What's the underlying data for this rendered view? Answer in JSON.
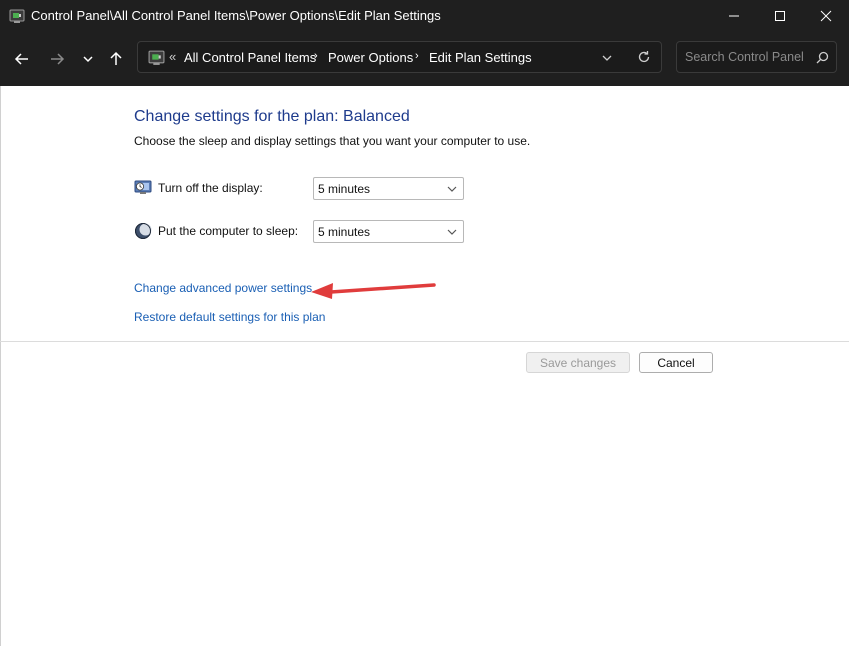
{
  "window": {
    "title": "Control Panel\\All Control Panel Items\\Power Options\\Edit Plan Settings",
    "controls": {
      "minimize": "minimize-icon",
      "maximize": "maximize-icon",
      "close": "close-icon"
    }
  },
  "navigation": {
    "back": "arrow-left-icon",
    "forward": "arrow-right-icon",
    "recent": "chevron-down-icon",
    "up": "arrow-up-icon"
  },
  "address": {
    "overflow": "«",
    "crumbs": [
      "All Control Panel Items",
      "Power Options",
      "Edit Plan Settings"
    ],
    "separator": "›"
  },
  "search": {
    "placeholder": "Search Control Panel"
  },
  "main": {
    "heading": "Change settings for the plan: Balanced",
    "description": "Choose the sleep and display settings that you want your computer to use.",
    "settings": [
      {
        "label": "Turn off the display:",
        "value": "5 minutes",
        "icon": "display-timer-icon"
      },
      {
        "label": "Put the computer to sleep:",
        "value": "5 minutes",
        "icon": "sleep-moon-icon"
      }
    ],
    "links": {
      "advanced": "Change advanced power settings",
      "restore": "Restore default settings for this plan"
    },
    "buttons": {
      "save": "Save changes",
      "cancel": "Cancel"
    }
  },
  "colors": {
    "chrome": "#1f1f1f",
    "heading": "#1e3b8c",
    "link": "#1a5fb4",
    "annotation_arrow": "#e03c3c"
  }
}
